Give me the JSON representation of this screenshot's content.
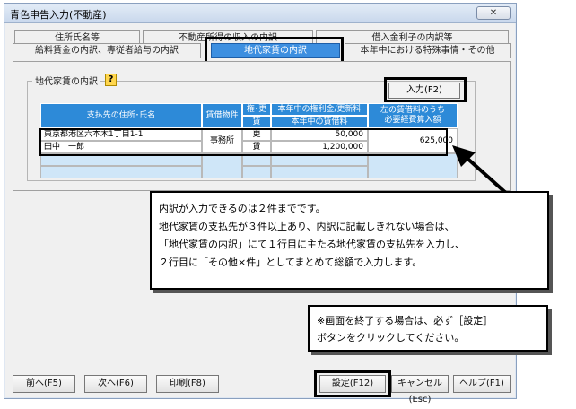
{
  "window": {
    "title": "青色申告入力(不動産)",
    "close_label": "✕"
  },
  "tabs": {
    "back": [
      "住所氏名等",
      "不動産所得の収入の内訳",
      "借入金利子の内訳等"
    ],
    "front": [
      "給料賃金の内訳、専従者給与の内訳",
      "地代家賃の内訳",
      "本年中における特殊事情・その他"
    ],
    "active": "地代家賃の内訳"
  },
  "group": {
    "label": "地代家賃の内訳",
    "help_icon": "help-icon",
    "input_button": "入力(F2)"
  },
  "table": {
    "headers": {
      "payee": "支払先の住所･氏名",
      "property": "賃借物件",
      "type_top": "権･更",
      "type_bottom": "賃",
      "amount_top": "本年中の権利金/更新料",
      "amount_bottom": "本年中の賃借料",
      "deductible": "左の賃借料のうち\n必要経費算入額"
    },
    "rows": [
      {
        "address": "東京都港区六本木1丁目1-1",
        "name": "田中　一郎",
        "property": "事務所",
        "type_top": "更",
        "type_bottom": "賃",
        "amount_top": "50,000",
        "amount_bottom": "1,200,000",
        "deductible": "625,000"
      }
    ]
  },
  "callout1": {
    "lines": [
      "内訳が入力できるのは２件までです。",
      "地代家賃の支払先が３件以上あり、内訳に記載しきれない場合は、",
      "「地代家賃の内訳」にて１行目に主たる地代家賃の支払先を入力し、",
      "２行目に「その他×件」としてまとめて総額で入力します。"
    ]
  },
  "callout2": {
    "lines": [
      "※画面を終了する場合は、必ず［設定］",
      "ボタンをクリックしてください。"
    ]
  },
  "footer": {
    "prev": "前へ(F5)",
    "next": "次へ(F6)",
    "print": "印刷(F8)",
    "settings": "設定(F12)",
    "cancel": "キャンセル(Esc)",
    "help": "ヘルプ(F1)"
  }
}
